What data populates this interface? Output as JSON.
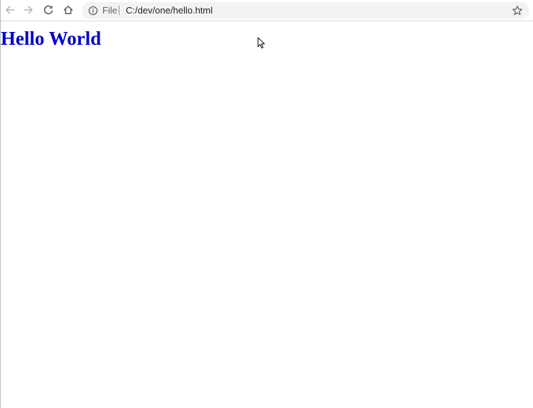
{
  "browser": {
    "address_bar": {
      "origin_label": "File",
      "url": "C:/dev/one/hello.html"
    },
    "icons": {
      "back": "arrow-left-icon",
      "forward": "arrow-right-icon",
      "reload": "reload-icon",
      "home": "home-icon",
      "site_info": "info-icon",
      "bookmark": "star-icon"
    }
  },
  "page": {
    "heading": "Hello World",
    "heading_color": "#0000cc"
  },
  "colors": {
    "toolbar_bg": "#ffffff",
    "omnibox_bg": "#f1f3f4",
    "icon_gray": "#5f6368",
    "icon_disabled": "#b4b6b9",
    "url_text": "#202124"
  }
}
